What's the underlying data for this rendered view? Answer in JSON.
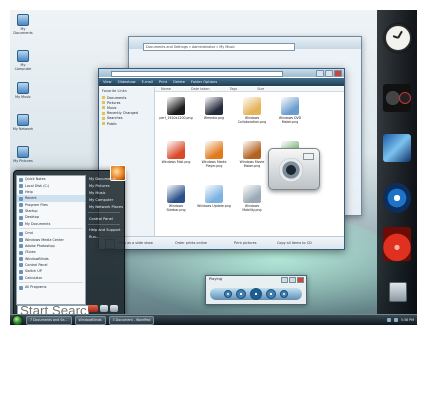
{
  "desktop": {
    "icons": [
      {
        "label": "My Documents",
        "icon": "folder-documents-icon"
      },
      {
        "label": "My Computer",
        "icon": "computer-icon"
      },
      {
        "label": "My Music",
        "icon": "music-folder-icon"
      },
      {
        "label": "My Network",
        "icon": "network-icon"
      },
      {
        "label": "My Pictures",
        "icon": "pictures-folder-icon"
      }
    ]
  },
  "explorer_back": {
    "address": "Documents and Settings » Administrator » My Music"
  },
  "explorer": {
    "address": "Computer » Local Disk (C:) » Windows » Icons",
    "command_bar": [
      "View",
      "Slideshow",
      "E-mail",
      "Print",
      "Delete",
      "Folder Options"
    ],
    "nav_header": "Favorite Links",
    "nav_items": [
      "Documents",
      "Pictures",
      "Music",
      "Recently Changed",
      "Searches",
      "Public"
    ],
    "columns": [
      "Name",
      "Date taken",
      "Tags",
      "Size"
    ],
    "files": [
      {
        "name": "perf_1920x1200.png",
        "color": "#1b1b1b"
      },
      {
        "name": "Wmedia.png",
        "color": "#242a3c"
      },
      {
        "name": "Windows Collaboration.png",
        "color": "#e4b35a"
      },
      {
        "name": "Windows DVD Maker.png",
        "color": "#6a9ccf"
      },
      {
        "name": "Windows Mail.png",
        "color": "#d94a2a"
      },
      {
        "name": "Windows Media Player.png",
        "color": "#e07a1c"
      },
      {
        "name": "Windows Movie Maker.png",
        "color": "#b4621f"
      },
      {
        "name": "Windows Photo.png",
        "color": "#7ab27a"
      },
      {
        "name": "Windows Sidebar.png",
        "color": "#2a4f8a"
      },
      {
        "name": "Windows Update.png",
        "color": "#7bb1e0"
      },
      {
        "name": "Windows Mobility.png",
        "color": "#9aa9b5"
      }
    ],
    "details_actions": [
      "Play as a slide show",
      "Order prints online",
      "Print pictures",
      "Copy all items to CD"
    ]
  },
  "start_menu": {
    "pinned": [
      {
        "label": "Quick Notes",
        "selected": false
      },
      {
        "label": "Local Disk (C:)",
        "selected": false
      },
      {
        "label": "Help",
        "selected": false
      },
      {
        "label": "Recent",
        "selected": true
      },
      {
        "label": "Program Files",
        "selected": false
      },
      {
        "label": "Startup",
        "selected": false
      },
      {
        "label": "Desktop",
        "selected": false
      },
      {
        "label": "My Documents",
        "selected": false
      }
    ],
    "recent": [
      {
        "label": "Cmd"
      },
      {
        "label": "Windows Media Center"
      },
      {
        "label": "Adobe Photoshop"
      },
      {
        "label": "iTunes"
      },
      {
        "label": "WindowBlinds"
      },
      {
        "label": "Control Panel"
      },
      {
        "label": "Switch UP"
      },
      {
        "label": "Calculator"
      }
    ],
    "all_programs": "All Programs",
    "right": [
      "My Documents",
      "My Pictures",
      "My Music",
      "My Computer",
      "My Network Places",
      "Control Panel",
      "Help and Support",
      "Run..."
    ],
    "search_placeholder": "Start Search"
  },
  "media_player": {
    "title": "Playing"
  },
  "taskbar": {
    "tasks": [
      "7 Documents and Se...",
      "WindowBlinds",
      "3 Document - WordPad"
    ],
    "clock": "5:36 PM"
  }
}
